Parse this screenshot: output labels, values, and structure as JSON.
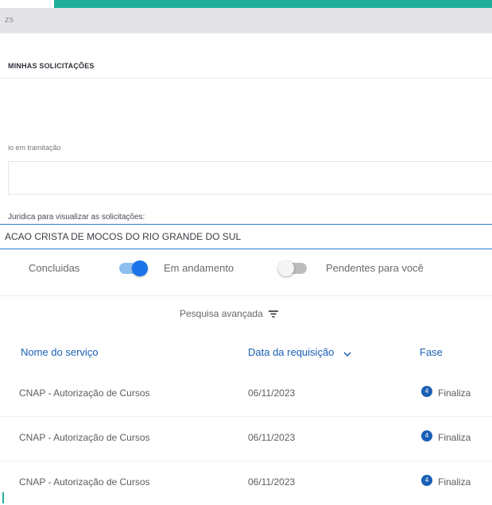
{
  "topbar": {
    "crumb": "zs"
  },
  "section": {
    "title": "MINHAS SOLICITAÇÕES"
  },
  "filters": {
    "tramitacao_label": "io em tramitação",
    "tramitacao_value": "",
    "pj_label": "Juridica para visualizar as solicitações:",
    "pj_value": "ACAO CRISTA DE MOCOS DO RIO GRANDE DO SUL"
  },
  "toggles": [
    {
      "label": "Concluidas",
      "state": "on"
    },
    {
      "label": "Em andamento",
      "state": "off"
    },
    {
      "label": "Pendentes para você"
    }
  ],
  "advanced_search": {
    "label": "Pesquisa avançada",
    "icon": "filter-icon"
  },
  "table": {
    "columns": [
      "Nome do serviço",
      "Data da requisição",
      "Fase"
    ],
    "rows": [
      {
        "servico": "CNAP - Autorização de Cursos",
        "data": "06/11/2023",
        "fase_icon": "4",
        "fase": "Finaliza"
      },
      {
        "servico": "CNAP - Autorização de Cursos",
        "data": "06/11/2023",
        "fase_icon": "4",
        "fase": "Finaliza"
      },
      {
        "servico": "CNAP - Autorização de Cursos",
        "data": "06/11/2023",
        "fase_icon": "4",
        "fase": "Finaliza"
      }
    ]
  },
  "colors": {
    "accent": "#1fae9a",
    "primary": "#1a5fb4",
    "toggle_on": "#1a73e8"
  }
}
